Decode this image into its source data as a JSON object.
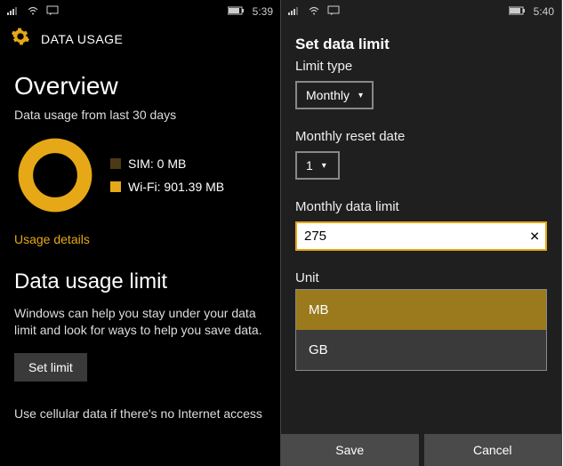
{
  "left": {
    "status": {
      "time": "5:39"
    },
    "header": {
      "title": "DATA USAGE"
    },
    "overview": {
      "title": "Overview",
      "subtitle": "Data usage from last 30 days",
      "sim_label": "SIM: 0 MB",
      "wifi_label": "Wi-Fi: 901.39 MB",
      "usage_details": "Usage details"
    },
    "limit": {
      "title": "Data usage limit",
      "desc": "Windows can help you stay under your data limit and look for ways to help you save data.",
      "set_limit": "Set limit",
      "cut": "Use cellular data if there's no Internet access"
    }
  },
  "right": {
    "status": {
      "time": "5:40"
    },
    "panel": {
      "title": "Set data limit",
      "limit_type_label": "Limit type",
      "limit_type_value": "Monthly",
      "reset_label": "Monthly reset date",
      "reset_value": "1",
      "data_limit_label": "Monthly data limit",
      "data_limit_value": "275",
      "unit_label": "Unit",
      "unit_options": {
        "mb": "MB",
        "gb": "GB"
      }
    },
    "buttons": {
      "save": "Save",
      "cancel": "Cancel"
    }
  },
  "chart_data": {
    "type": "pie",
    "title": "Data usage from last 30 days",
    "series": [
      {
        "name": "SIM",
        "value": 0,
        "unit": "MB",
        "color": "#4a3a15"
      },
      {
        "name": "Wi-Fi",
        "value": 901.39,
        "unit": "MB",
        "color": "#e6a817"
      }
    ]
  }
}
